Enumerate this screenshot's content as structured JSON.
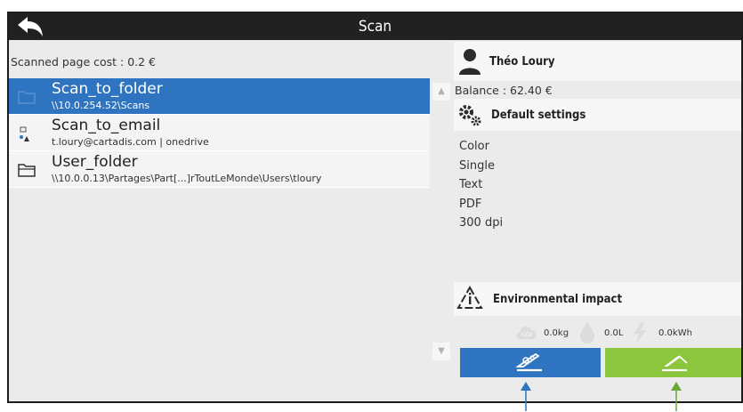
{
  "header": {
    "title": "Scan",
    "back_icon": "back-arrow-icon"
  },
  "cost": {
    "text": "Scanned page cost : 0.2 €"
  },
  "destinations": [
    {
      "name": "Scan_to_folder",
      "path": "\\\\10.0.254.52\\Scans",
      "icon": "folder-icon",
      "selected": true
    },
    {
      "name": "Scan_to_email",
      "path": "t.loury@cartadis.com | onedrive",
      "icon": "email-users-icon",
      "selected": false
    },
    {
      "name": "User_folder",
      "path": "\\\\10.0.0.13\\Partages\\Part[...]rToutLeMonde\\Users\\tloury",
      "icon": "folder-icon",
      "selected": false
    }
  ],
  "user": {
    "name": "Théo Loury",
    "balance": "Balance : 62.40 €",
    "icon": "user-icon"
  },
  "settings": {
    "title": "Default settings",
    "icon": "gears-icon",
    "items": [
      "Color",
      "Single",
      "Text",
      "PDF",
      "300 dpi"
    ]
  },
  "environment": {
    "title": "Environmental impact",
    "icon": "recycle-info-icon",
    "co2": "0.0kg",
    "water": "0.0L",
    "energy": "0.0kWh"
  },
  "actions": {
    "settings_icon": "scanner-settings-icon",
    "scan_icon": "scanner-icon"
  },
  "colors": {
    "header": "#212121",
    "selected": "#2e74c0",
    "panel": "#ebebeb",
    "scan_button": "#8cc63f",
    "settings_button": "#2e74c0"
  }
}
